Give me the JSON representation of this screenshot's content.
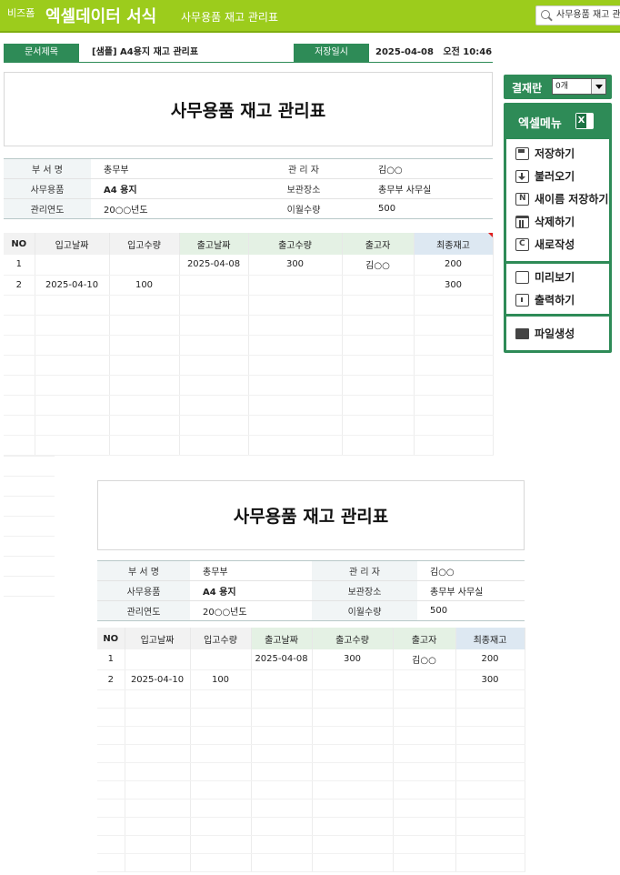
{
  "header": {
    "brand_small": "비즈폼",
    "brand_big": "엑셀데이터 서식",
    "subtitle": "사무용품 재고 관리표",
    "search_text": "사무용품 재고 관리표"
  },
  "doc": {
    "title_label": "문서제목",
    "title_value": "[샘플] A4용지 재고 관리표",
    "date_label": "저장일시",
    "date_value": "2025-04-08   오전 10:46"
  },
  "sheet": {
    "title": "사무용품 재고 관리표",
    "info": {
      "row1": {
        "l1": "부 서 명",
        "v1": "총무부",
        "l2": "관 리 자",
        "v2": "김○○"
      },
      "row2": {
        "l1": "사무용품",
        "v1": "A4 용지",
        "l2": "보관장소",
        "v2": "총무부 사무실"
      },
      "row3": {
        "l1": "관리연도",
        "v1": "20○○년도",
        "l2": "이월수량",
        "v2": "500"
      }
    },
    "columns": [
      "NO",
      "입고날짜",
      "입고수량",
      "출고날짜",
      "출고수량",
      "출고자",
      "최종재고"
    ],
    "rows": [
      [
        "1",
        "",
        "",
        "2025-04-08",
        "300",
        "김○○",
        "200"
      ],
      [
        "2",
        "2025-04-10",
        "100",
        "",
        "",
        "",
        "300"
      ]
    ]
  },
  "panel": {
    "approval_label": "결재란",
    "approval_value": "0개",
    "menu_title": "엑셀메뉴",
    "items": {
      "save": "저장하기",
      "open": "불러오기",
      "saveas": "새이름 저장하기",
      "delete": "삭제하기",
      "new": "새로작성",
      "preview": "미리보기",
      "print": "출력하기",
      "file": "파일생성"
    }
  },
  "colors": {
    "header_green": "#9ccc1c",
    "menu_green": "#2e8b57",
    "out_header": "#e4f1e4",
    "stock_header": "#dde8f2"
  }
}
